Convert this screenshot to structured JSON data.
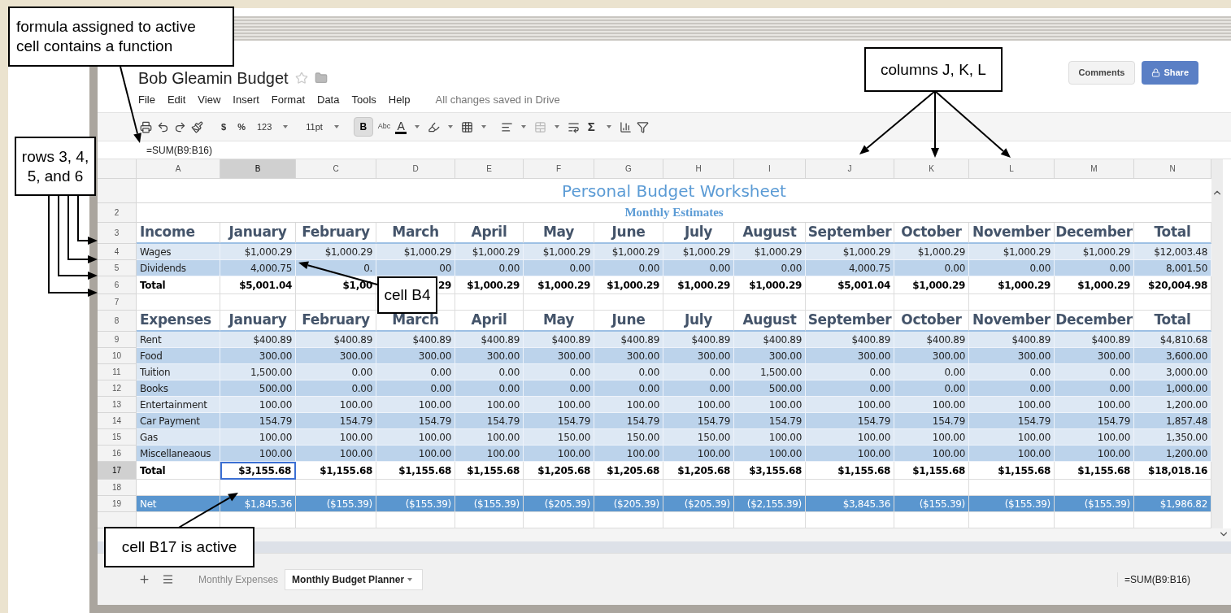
{
  "window": {
    "title": "Bob Gleamin Budget",
    "menus": [
      "File",
      "Edit",
      "View",
      "Insert",
      "Format",
      "Data",
      "Tools",
      "Help"
    ],
    "save_status": "All changes saved in Drive",
    "comments_button": "Comments",
    "share_button": "Share"
  },
  "toolbar": {
    "currency": "$",
    "percent": "%",
    "number_format": "123",
    "font_size": "11pt",
    "bold": {
      "label": "B",
      "selected": true
    },
    "strikethrough": "Abc",
    "text_color": "A",
    "functions": "Σ"
  },
  "formula_bar": {
    "value": "=SUM(B9:B16)"
  },
  "columns": [
    {
      "label": "A",
      "selected": false
    },
    {
      "label": "B",
      "selected": true
    },
    {
      "label": "C",
      "selected": false
    },
    {
      "label": "D",
      "selected": false
    },
    {
      "label": "E",
      "selected": false
    },
    {
      "label": "F",
      "selected": false
    },
    {
      "label": "G",
      "selected": false
    },
    {
      "label": "H",
      "selected": false
    },
    {
      "label": "I",
      "selected": false
    },
    {
      "label": "J",
      "selected": false
    },
    {
      "label": "K",
      "selected": false
    },
    {
      "label": "L",
      "selected": false
    },
    {
      "label": "M",
      "selected": false
    },
    {
      "label": "N",
      "selected": false
    }
  ],
  "rows": [
    {
      "kind": "title",
      "selected": false,
      "text": "Personal Budget Worksheet"
    },
    {
      "number": "2",
      "kind": "subtitle",
      "selected": false,
      "text": "Monthly Estimates"
    },
    {
      "number": "3",
      "kind": "header",
      "selected": false,
      "cells": [
        "Income",
        "January",
        "February",
        "March",
        "April",
        "May",
        "June",
        "July",
        "August",
        "September",
        "October",
        "November",
        "December",
        "Total"
      ]
    },
    {
      "number": "4",
      "kind": "light",
      "selected": false,
      "cells": [
        "Wages",
        "$1,000.29",
        "$1,000.29",
        "$1,000.29",
        "$1,000.29",
        "$1,000.29",
        "$1,000.29",
        "$1,000.29",
        "$1,000.29",
        "$1,000.29",
        "$1,000.29",
        "$1,000.29",
        "$1,000.29",
        "$12,003.48"
      ]
    },
    {
      "number": "5",
      "kind": "dark",
      "selected": false,
      "cells": [
        "Dividends",
        "4,000.75",
        "0.",
        "00",
        "0.00",
        "0.00",
        "0.00",
        "0.00",
        "0.00",
        "4,000.75",
        "0.00",
        "0.00",
        "0.00",
        "8,001.50"
      ]
    },
    {
      "number": "6",
      "kind": "total",
      "selected": false,
      "cells": [
        "Total",
        "$5,001.04",
        "$1,00",
        "29",
        "$1,000.29",
        "$1,000.29",
        "$1,000.29",
        "$1,000.29",
        "$1,000.29",
        "$5,001.04",
        "$1,000.29",
        "$1,000.29",
        "$1,000.29",
        "$20,004.98"
      ]
    },
    {
      "number": "7",
      "kind": "blank",
      "selected": false
    },
    {
      "number": "8",
      "kind": "header",
      "selected": false,
      "cells": [
        "Expenses",
        "January",
        "February",
        "March",
        "April",
        "May",
        "June",
        "July",
        "August",
        "September",
        "October",
        "November",
        "December",
        "Total"
      ]
    },
    {
      "number": "9",
      "kind": "light",
      "selected": false,
      "cells": [
        "Rent",
        "$400.89",
        "$400.89",
        "$400.89",
        "$400.89",
        "$400.89",
        "$400.89",
        "$400.89",
        "$400.89",
        "$400.89",
        "$400.89",
        "$400.89",
        "$400.89",
        "$4,810.68"
      ]
    },
    {
      "number": "10",
      "kind": "dark",
      "selected": false,
      "cells": [
        "Food",
        "300.00",
        "300.00",
        "300.00",
        "300.00",
        "300.00",
        "300.00",
        "300.00",
        "300.00",
        "300.00",
        "300.00",
        "300.00",
        "300.00",
        "3,600.00"
      ]
    },
    {
      "number": "11",
      "kind": "light",
      "selected": false,
      "cells": [
        "Tuition",
        "1,500.00",
        "0.00",
        "0.00",
        "0.00",
        "0.00",
        "0.00",
        "0.00",
        "1,500.00",
        "0.00",
        "0.00",
        "0.00",
        "0.00",
        "3,000.00"
      ]
    },
    {
      "number": "12",
      "kind": "dark",
      "selected": false,
      "cells": [
        "Books",
        "500.00",
        "0.00",
        "0.00",
        "0.00",
        "0.00",
        "0.00",
        "0.00",
        "500.00",
        "0.00",
        "0.00",
        "0.00",
        "0.00",
        "1,000.00"
      ]
    },
    {
      "number": "13",
      "kind": "light",
      "selected": false,
      "cells": [
        "Entertainment",
        "100.00",
        "100.00",
        "100.00",
        "100.00",
        "100.00",
        "100.00",
        "100.00",
        "100.00",
        "100.00",
        "100.00",
        "100.00",
        "100.00",
        "1,200.00"
      ]
    },
    {
      "number": "14",
      "kind": "dark",
      "selected": false,
      "cells": [
        "Car Payment",
        "154.79",
        "154.79",
        "154.79",
        "154.79",
        "154.79",
        "154.79",
        "154.79",
        "154.79",
        "154.79",
        "154.79",
        "154.79",
        "154.79",
        "1,857.48"
      ]
    },
    {
      "number": "15",
      "kind": "light",
      "selected": false,
      "cells": [
        "Gas",
        "100.00",
        "100.00",
        "100.00",
        "100.00",
        "150.00",
        "150.00",
        "150.00",
        "100.00",
        "100.00",
        "100.00",
        "100.00",
        "100.00",
        "1,350.00"
      ]
    },
    {
      "number": "16",
      "kind": "dark",
      "selected": false,
      "cells": [
        "Miscellaneaous",
        "100.00",
        "100.00",
        "100.00",
        "100.00",
        "100.00",
        "100.00",
        "100.00",
        "100.00",
        "100.00",
        "100.00",
        "100.00",
        "100.00",
        "1,200.00"
      ]
    },
    {
      "number": "17",
      "kind": "total",
      "selected": true,
      "cells": [
        "Total",
        "$3,155.68",
        "$1,155.68",
        "$1,155.68",
        "$1,155.68",
        "$1,205.68",
        "$1,205.68",
        "$1,205.68",
        "$3,155.68",
        "$1,155.68",
        "$1,155.68",
        "$1,155.68",
        "$1,155.68",
        "$18,018.16"
      ]
    },
    {
      "number": "18",
      "kind": "blank",
      "selected": false
    },
    {
      "number": "19",
      "kind": "net",
      "selected": false,
      "cells": [
        "Net",
        "$1,845.36",
        "($155.39)",
        "($155.39)",
        "($155.39)",
        "($205.39)",
        "($205.39)",
        "($205.39)",
        "($2,155.39)",
        "$3,845.36",
        "($155.39)",
        "($155.39)",
        "($155.39)",
        "$1,986.82"
      ]
    },
    {
      "kind": "blank",
      "selected": false
    }
  ],
  "sheet_tabs": [
    {
      "label": "Monthly Expenses",
      "selected": false
    },
    {
      "label": "Monthly Budget Planner",
      "selected": true
    }
  ],
  "status_formula": "=SUM(B9:B16)",
  "callouts": [
    {
      "text": "formula assigned to active cell contains a function"
    },
    {
      "text": "columns J, K, L"
    },
    {
      "text": "rows 3, 4, 5, and 6"
    },
    {
      "text": "cell B4"
    },
    {
      "text": "cell B17 is active"
    }
  ]
}
